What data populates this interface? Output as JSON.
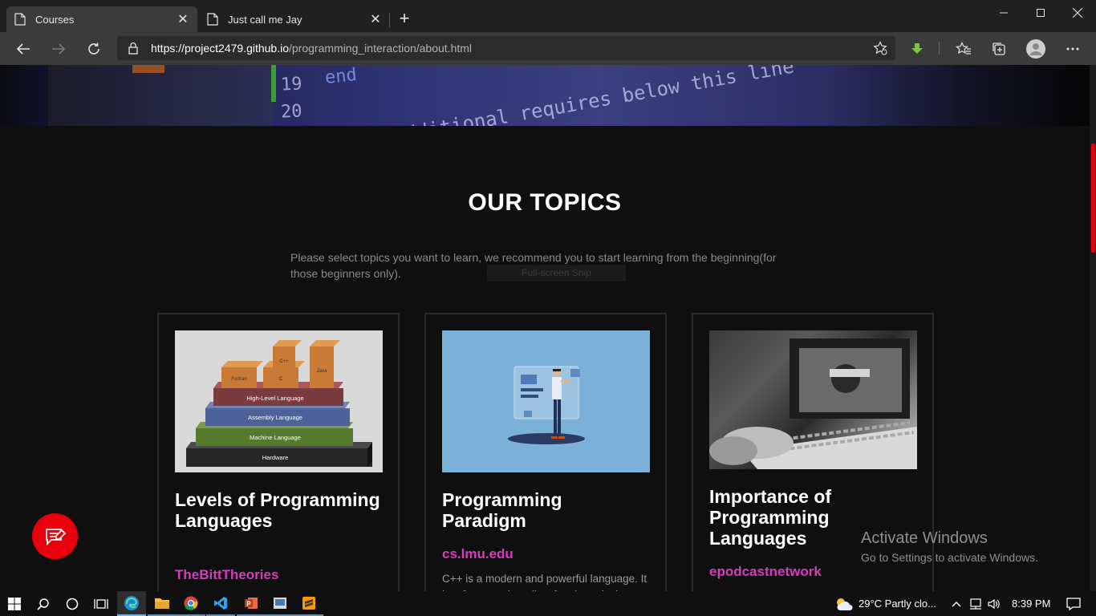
{
  "browser": {
    "tabs": [
      {
        "title": "Courses",
        "active": true
      },
      {
        "title": "Just call me Jay",
        "active": false
      }
    ],
    "url_host": "https://project2479.github.io",
    "url_path": "/programming_interaction/about.html"
  },
  "page": {
    "section_title": "OUR TOPICS",
    "intro": "Please select topics you want to learn, we recommend you to start learning from the beginning(for those beginners only).",
    "snip_overlay": "Full-screen Snip",
    "hero_code": [
      "end",
      "19",
      "20",
      "add additional requires below this line"
    ],
    "cards": [
      {
        "title": "Levels of Programming Languages",
        "source": "TheBittTheories",
        "description": "",
        "image_labels": {
          "blocks": [
            "C++",
            "Fortran",
            "C",
            "Java"
          ],
          "layers": [
            "High-Level Language",
            "Assembly Language",
            "Machine Language",
            "Hardware"
          ]
        }
      },
      {
        "title": "Programming Paradigm",
        "source": "cs.lmu.edu",
        "description": "C++ is a modern and powerful language. It has features that allow for clean design..."
      },
      {
        "title": "Importance of Programming Languages",
        "source": "epodcastnetwork",
        "description": ""
      }
    ]
  },
  "watermark": {
    "line1": "Activate Windows",
    "line2": "Go to Settings to activate Windows."
  },
  "taskbar": {
    "weather": "29°C  Partly clo...",
    "time": "8:39 PM"
  },
  "colors": {
    "accent_link": "#d63cc0",
    "fab": "#e8000d",
    "scroll_thumb": "#e3000f"
  },
  "icons": [
    "page-icon",
    "close-icon",
    "plus-icon",
    "back-icon",
    "forward-icon",
    "refresh-icon",
    "lock-icon",
    "add-favorite-icon",
    "download-icon",
    "favorites-icon",
    "collections-icon",
    "profile-icon",
    "more-icon",
    "feedback-icon",
    "windows-icon",
    "search-icon",
    "cortana-icon",
    "task-view-icon",
    "edge-icon",
    "folder-icon",
    "chrome-icon",
    "vscode-icon",
    "powerpoint-icon",
    "app-icon",
    "sublime-icon",
    "weather-icon",
    "chevron-up-icon",
    "network-icon",
    "volume-icon",
    "notification-icon"
  ]
}
